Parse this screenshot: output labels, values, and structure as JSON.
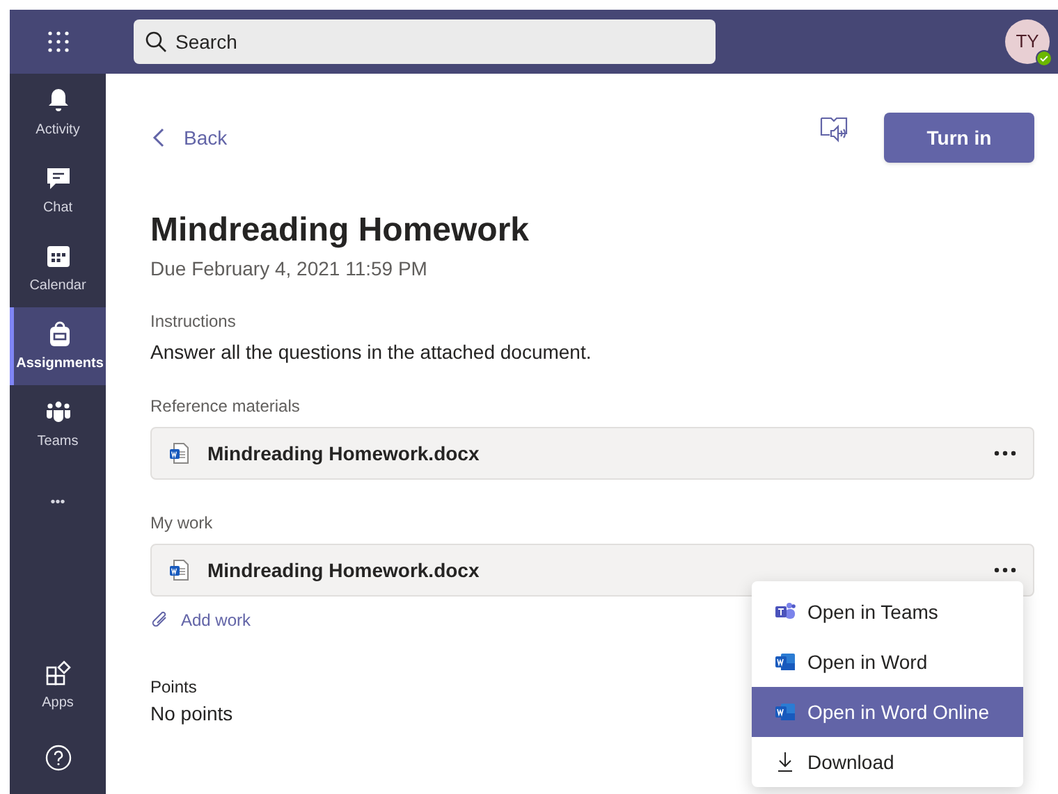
{
  "search": {
    "placeholder": "Search"
  },
  "avatar": {
    "initials": "TY",
    "online": true
  },
  "sidebar": {
    "items": [
      {
        "label": "Activity",
        "kind": "bell",
        "selected": false
      },
      {
        "label": "Chat",
        "kind": "chat",
        "selected": false
      },
      {
        "label": "Calendar",
        "kind": "calendar",
        "selected": false
      },
      {
        "label": "Assignments",
        "kind": "bag",
        "selected": true
      },
      {
        "label": "Teams",
        "kind": "teams",
        "selected": false
      },
      {
        "label": "•••",
        "kind": "more",
        "selected": false
      }
    ],
    "bottom_items": [
      {
        "label": "Apps",
        "kind": "apps"
      },
      {
        "kind": "help"
      }
    ]
  },
  "back": "Back",
  "turn_in": "Turn in",
  "title": "Mindreading Homework",
  "due": "Due February 4, 2021 11:59 PM",
  "instructions": {
    "label": "Instructions",
    "text": "Answer all the questions in the attached document."
  },
  "reference": {
    "label": "Reference materials",
    "file": "Mindreading Homework.docx"
  },
  "my_work": {
    "label": "My work",
    "file": "Mindreading Homework.docx",
    "add": "Add work"
  },
  "points": {
    "label": "Points",
    "value": "No points"
  },
  "menu": [
    {
      "label": "Open in Teams",
      "kind": "teams",
      "selected": false
    },
    {
      "label": "Open in Word",
      "kind": "word",
      "selected": false
    },
    {
      "label": "Open in Word Online",
      "kind": "word",
      "selected": true
    },
    {
      "label": "Download",
      "kind": "download",
      "selected": false
    }
  ]
}
